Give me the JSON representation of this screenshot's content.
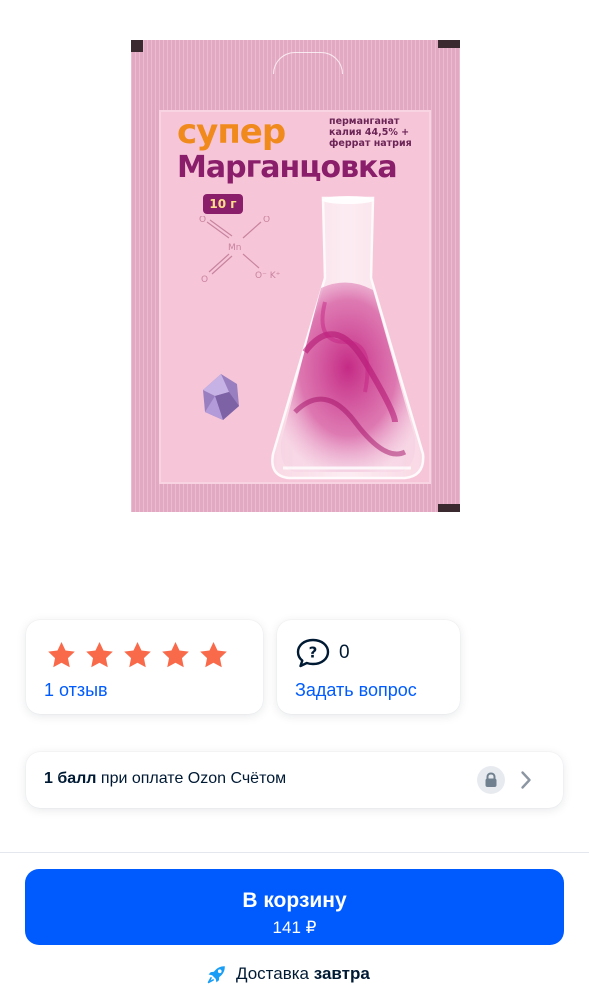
{
  "product": {
    "image": {
      "brand_top": "супер",
      "brand_main": "Марганцовка",
      "composition": [
        "перманганат",
        "калия 44,5% +",
        "феррат натрия"
      ],
      "weight": "10 г",
      "formula": {
        "center": "Mn",
        "oxygen": "O",
        "ion": "O⁻ K⁺"
      }
    }
  },
  "rating": {
    "stars": 5,
    "star_color": "#f96a4b",
    "reviews_label": "1 отзыв"
  },
  "questions": {
    "count": "0",
    "ask_label": "Задать вопрос",
    "icon": "question-bubble-icon"
  },
  "points": {
    "bold": "1 балл",
    "text": " при оплате Ozon Счётом",
    "icons": [
      "lock-icon",
      "chevron-right-icon"
    ]
  },
  "cart": {
    "label": "В корзину",
    "price": "141 ₽",
    "color": "#005bff"
  },
  "delivery": {
    "prefix": "Доставка ",
    "bold": "завтра",
    "icon": "rocket-icon"
  }
}
